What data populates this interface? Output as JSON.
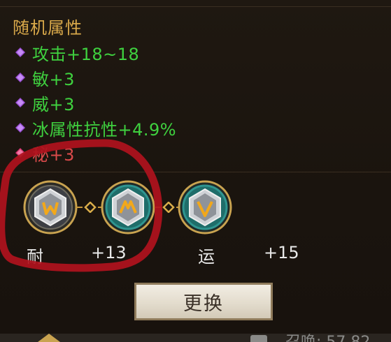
{
  "section": {
    "title": "随机属性"
  },
  "attributes": [
    {
      "text": "攻击+18~18",
      "bullet": "purple-diamond-bullet"
    },
    {
      "text": "敏+3",
      "bullet": "purple-diamond-bullet"
    },
    {
      "text": "威+3",
      "bullet": "purple-diamond-bullet"
    },
    {
      "text": "冰属性抗性+4.9%",
      "bullet": "purple-diamond-bullet"
    },
    {
      "text": "秘+3",
      "bullet": "pink-diamond-bullet"
    }
  ],
  "gems": [
    {
      "icon": "rune-gem-icon",
      "style": "silver"
    },
    {
      "icon": "rune-gem-icon",
      "style": "teal"
    },
    {
      "icon": "rune-gem-icon",
      "style": "teal"
    }
  ],
  "links": [
    {
      "icon": "chain-link-icon"
    },
    {
      "icon": "chain-link-icon"
    }
  ],
  "stats": [
    {
      "name": "耐",
      "value": "+13"
    },
    {
      "name": "运",
      "value": "+15"
    }
  ],
  "button": {
    "label": "更换"
  },
  "footer": {
    "text": "召唤: 57.82"
  },
  "colors": {
    "title": "#d9a94a",
    "attribute_green": "#3fd13f",
    "attribute_red": "#d94a4a",
    "annotation_red": "#b0121d"
  }
}
